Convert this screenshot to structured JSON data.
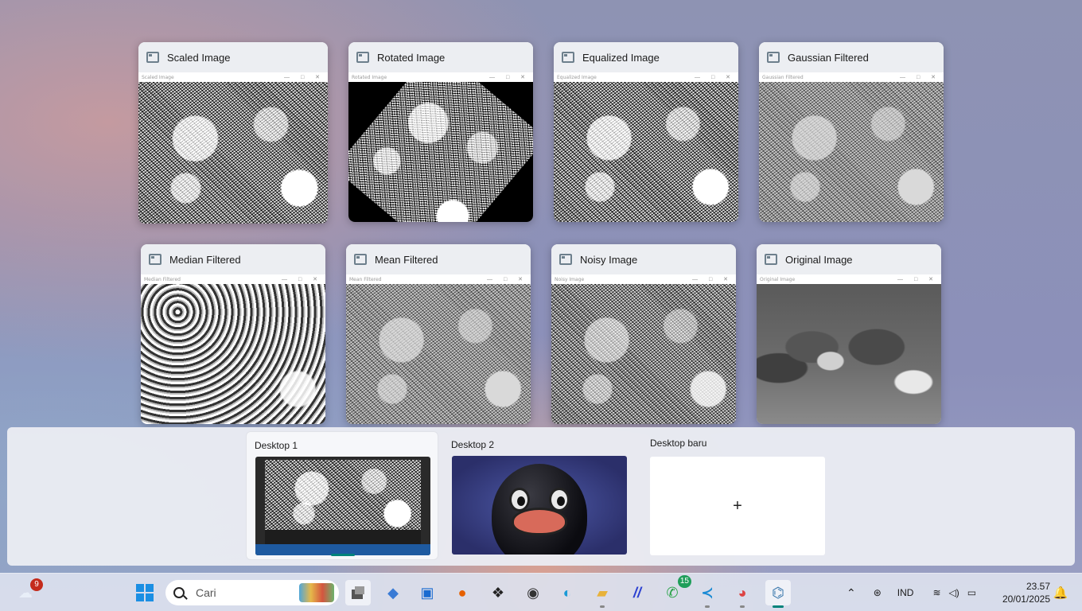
{
  "windows": [
    {
      "title": "Scaled Image",
      "inner": "Scaled Image"
    },
    {
      "title": "Rotated Image",
      "inner": "Rotated Image"
    },
    {
      "title": "Equalized Image",
      "inner": "Equalized Image"
    },
    {
      "title": "Gaussian Filtered",
      "inner": "Gaussian Filtered"
    },
    {
      "title": "Median Filtered",
      "inner": "Median Filtered"
    },
    {
      "title": "Mean Filtered",
      "inner": "Mean Filtered"
    },
    {
      "title": "Noisy Image",
      "inner": "Noisy Image"
    },
    {
      "title": "Original Image",
      "inner": "Original Image"
    }
  ],
  "desktops": {
    "d1": "Desktop 1",
    "d2": "Desktop 2",
    "new": "Desktop baru",
    "new_icon": "+"
  },
  "taskbar": {
    "weather_badge": "9",
    "search_placeholder": "Cari",
    "whatsapp_badge": "15",
    "language": "IND",
    "time": "23.57",
    "date": "20/01/2025"
  },
  "colors": {
    "accent": "#00837a",
    "vscode": "#1a8ad4"
  }
}
